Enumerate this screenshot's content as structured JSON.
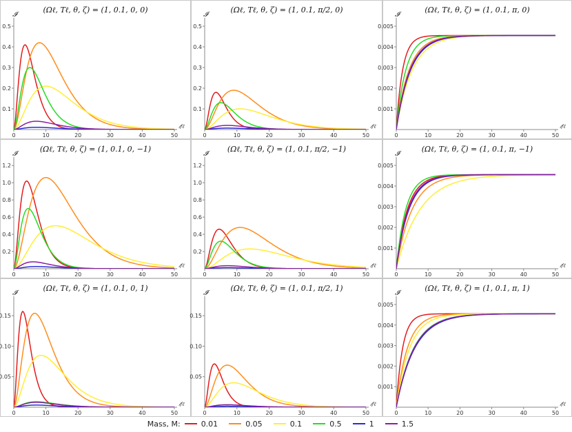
{
  "figure": {
    "legend_title": "Mass, M:"
  },
  "chart_data": [
    {
      "type": "line",
      "title": "(Ωℓ, Tℓ, θ, ζ) = (1, 0.1, 0, 0)",
      "xlabel": "𝓉/ℓ",
      "ylabel": "𝓘",
      "xlim": [
        0,
        50
      ],
      "ylim": [
        0,
        0.52
      ],
      "xticks": [
        "0",
        "10",
        "20",
        "30",
        "40",
        "50"
      ],
      "yticks": [
        "0.1",
        "0.2",
        "0.3",
        "0.4",
        "0.5"
      ],
      "peaks": [
        {
          "x": 3.5,
          "y": 0.41
        },
        {
          "x": 8,
          "y": 0.42
        },
        {
          "x": 10,
          "y": 0.21
        },
        {
          "x": 5,
          "y": 0.3
        },
        {
          "x": 7,
          "y": 0.011
        },
        {
          "x": 7,
          "y": 0.04
        }
      ]
    },
    {
      "type": "line",
      "title": "(Ωℓ, Tℓ, θ, ζ) = (1, 0.1, π/2, 0)",
      "xlabel": "𝓉/ℓ",
      "ylabel": "𝓘",
      "xlim": [
        0,
        50
      ],
      "ylim": [
        0,
        0.52
      ],
      "xticks": [
        "0",
        "10",
        "20",
        "30",
        "40",
        "50"
      ],
      "yticks": [
        "0.1",
        "0.2",
        "0.3",
        "0.4",
        "0.5"
      ],
      "peaks": [
        {
          "x": 3.5,
          "y": 0.18
        },
        {
          "x": 9,
          "y": 0.19
        },
        {
          "x": 11,
          "y": 0.1
        },
        {
          "x": 5,
          "y": 0.13
        },
        {
          "x": 7,
          "y": 0.007
        },
        {
          "x": 7,
          "y": 0.02
        }
      ]
    },
    {
      "type": "line",
      "title": "(Ωℓ, Tℓ, θ, ζ) = (1, 0.1, π, 0)",
      "xlabel": "𝓉/ℓ",
      "ylabel": "𝓘",
      "xlim": [
        0,
        50
      ],
      "ylim": [
        0,
        0.0052
      ],
      "xticks": [
        "0",
        "10",
        "20",
        "30",
        "40",
        "50"
      ],
      "yticks": [
        "0.001",
        "0.002",
        "0.003",
        "0.004",
        "0.005"
      ],
      "saturation": 0.00455,
      "time_constants": [
        2.0,
        4.0,
        5.0,
        3.0,
        4.5,
        4.3
      ]
    },
    {
      "type": "line",
      "title": "(Ωℓ, Tℓ, θ, ζ) = (1, 0.1, 0, −1)",
      "xlabel": "𝓉/ℓ",
      "ylabel": "𝓘",
      "xlim": [
        0,
        50
      ],
      "ylim": [
        0,
        1.25
      ],
      "xticks": [
        "0",
        "10",
        "20",
        "30",
        "40",
        "50"
      ],
      "yticks": [
        "0.2",
        "0.4",
        "0.6",
        "0.8",
        "1.0",
        "1.2"
      ],
      "peaks": [
        {
          "x": 4,
          "y": 1.02
        },
        {
          "x": 10,
          "y": 1.06
        },
        {
          "x": 13,
          "y": 0.5
        },
        {
          "x": 4.5,
          "y": 0.7
        },
        {
          "x": 7,
          "y": 0.025
        },
        {
          "x": 6,
          "y": 0.08
        }
      ]
    },
    {
      "type": "line",
      "title": "(Ωℓ, Tℓ, θ, ζ) = (1, 0.1, π/2, −1)",
      "xlabel": "𝓉/ℓ",
      "ylabel": "𝓘",
      "xlim": [
        0,
        50
      ],
      "ylim": [
        0,
        1.25
      ],
      "xticks": [
        "0",
        "10",
        "20",
        "30",
        "40",
        "50"
      ],
      "yticks": [
        "0.2",
        "0.4",
        "0.6",
        "0.8",
        "1.0",
        "1.2"
      ],
      "peaks": [
        {
          "x": 4.5,
          "y": 0.46
        },
        {
          "x": 11,
          "y": 0.48
        },
        {
          "x": 14,
          "y": 0.23
        },
        {
          "x": 5,
          "y": 0.32
        },
        {
          "x": 7,
          "y": 0.012
        },
        {
          "x": 7,
          "y": 0.035
        }
      ]
    },
    {
      "type": "line",
      "title": "(Ωℓ, Tℓ, θ, ζ) = (1, 0.1, π, −1)",
      "xlabel": "𝓉/ℓ",
      "ylabel": "𝓘",
      "xlim": [
        0,
        50
      ],
      "ylim": [
        0,
        0.0052
      ],
      "xticks": [
        "0",
        "10",
        "20",
        "30",
        "40",
        "50"
      ],
      "yticks": [
        "0.001",
        "0.002",
        "0.003",
        "0.004",
        "0.005"
      ],
      "saturation": 0.00455,
      "time_constants": [
        3.5,
        5.0,
        7.5,
        3.0,
        4.0,
        3.8
      ]
    },
    {
      "type": "line",
      "title": "(Ωℓ, Tℓ, θ, ζ) = (1, 0.1, 0, 1)",
      "xlabel": "𝓉/ℓ",
      "ylabel": "𝓘",
      "xlim": [
        0,
        50
      ],
      "ylim": [
        0,
        0.175
      ],
      "xticks": [
        "0",
        "10",
        "20",
        "30",
        "40",
        "50"
      ],
      "yticks": [
        "0.05",
        "0.10",
        "0.15"
      ],
      "peaks": [
        {
          "x": 2.8,
          "y": 0.157
        },
        {
          "x": 6.5,
          "y": 0.154
        },
        {
          "x": 8.5,
          "y": 0.085
        },
        {
          "x": 7,
          "y": 0.009
        },
        {
          "x": 7,
          "y": 0.0035
        },
        {
          "x": 7,
          "y": 0.008
        }
      ]
    },
    {
      "type": "line",
      "title": "(Ωℓ, Tℓ, θ, ζ) = (1, 0.1, π/2, 1)",
      "xlabel": "𝓉/ℓ",
      "ylabel": "𝓘",
      "xlim": [
        0,
        50
      ],
      "ylim": [
        0,
        0.175
      ],
      "xticks": [
        "0",
        "10",
        "20",
        "30",
        "40",
        "50"
      ],
      "yticks": [
        "0.05",
        "0.10",
        "0.15"
      ],
      "peaks": [
        {
          "x": 3,
          "y": 0.071
        },
        {
          "x": 7,
          "y": 0.069
        },
        {
          "x": 9,
          "y": 0.04
        },
        {
          "x": 7,
          "y": 0.004
        },
        {
          "x": 7,
          "y": 0.0015
        },
        {
          "x": 7,
          "y": 0.004
        }
      ]
    },
    {
      "type": "line",
      "title": "(Ωℓ, Tℓ, θ, ζ) = (1, 0.1, π, 1)",
      "xlabel": "𝓉/ℓ",
      "ylabel": "𝓘",
      "xlim": [
        0,
        50
      ],
      "ylim": [
        0,
        0.0052
      ],
      "xticks": [
        "0",
        "10",
        "20",
        "30",
        "40",
        "50"
      ],
      "yticks": [
        "0.001",
        "0.002",
        "0.003",
        "0.004",
        "0.005"
      ],
      "saturation": 0.00455,
      "time_constants": [
        2.0,
        3.5,
        4.2,
        5.5,
        5.8,
        5.6
      ]
    }
  ],
  "series": [
    {
      "name": "0.01",
      "color": "#e31a1c"
    },
    {
      "name": "0.05",
      "color": "#ff8c1a"
    },
    {
      "name": "0.1",
      "color": "#ffee33"
    },
    {
      "name": "0.5",
      "color": "#22dd22"
    },
    {
      "name": "1",
      "color": "#2a2ad6"
    },
    {
      "name": "1.5",
      "color": "#8a1ca0"
    }
  ]
}
